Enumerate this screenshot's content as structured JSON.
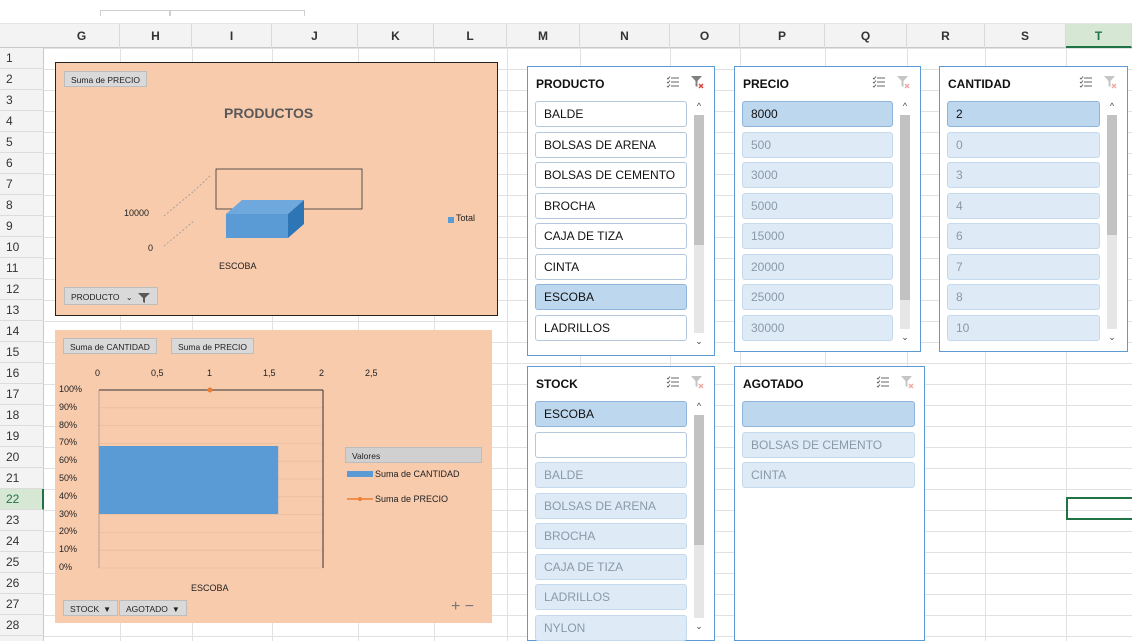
{
  "columns": [
    "G",
    "H",
    "I",
    "J",
    "K",
    "L",
    "M",
    "N",
    "O",
    "P",
    "Q",
    "R",
    "S",
    "T"
  ],
  "selected_column": "T",
  "rows": [
    "1",
    "2",
    "3",
    "4",
    "5",
    "6",
    "7",
    "8",
    "9",
    "10",
    "11",
    "12",
    "13",
    "14",
    "15",
    "16",
    "17",
    "18",
    "19",
    "20",
    "21",
    "22",
    "23",
    "24",
    "25",
    "26",
    "27",
    "28"
  ],
  "selected_row": "22",
  "chart1": {
    "type": "bar3d",
    "title": "PRODUCTOS",
    "value_field": "Suma de PRECIO",
    "filter_field": "PRODUCTO",
    "y_ticks": [
      "0",
      "10000"
    ],
    "category": "ESCOBA",
    "series_name": "Total",
    "value": 8000,
    "ylim": [
      0,
      20000
    ],
    "colors": {
      "bar": "#5b9bd5"
    }
  },
  "chart2": {
    "field_buttons": [
      "Suma de CANTIDAD",
      "Suma de PRECIO"
    ],
    "filter_fields": [
      "STOCK",
      "AGOTADO"
    ],
    "top_axis_ticks": [
      "0",
      "0,5",
      "1",
      "1,5",
      "2",
      "2,5"
    ],
    "left_axis_ticks": [
      "100%",
      "90%",
      "80%",
      "70%",
      "60%",
      "50%",
      "40%",
      "30%",
      "20%",
      "10%",
      "0%"
    ],
    "category": "ESCOBA",
    "legend_title": "Valores",
    "expand_collapse": "+ −"
  },
  "chart_data": [
    {
      "type": "bar",
      "title": "PRODUCTOS",
      "categories": [
        "ESCOBA"
      ],
      "series": [
        {
          "name": "Total",
          "values": [
            8000
          ]
        }
      ]
    },
    {
      "type": "bar",
      "categories": [
        "ESCOBA"
      ],
      "series": [
        {
          "name": "Suma de CANTIDAD",
          "values": [
            2
          ]
        },
        {
          "name": "Suma de PRECIO",
          "values": [
            8000
          ]
        }
      ],
      "xlim": [
        0,
        2.5
      ]
    }
  ],
  "slicers": {
    "producto": {
      "title": "PRODUCTO",
      "items": [
        {
          "label": "BALDE",
          "state": "on"
        },
        {
          "label": "BOLSAS DE ARENA",
          "state": "on"
        },
        {
          "label": "BOLSAS DE CEMENTO",
          "state": "on"
        },
        {
          "label": "BROCHA",
          "state": "on"
        },
        {
          "label": "CAJA DE TIZA",
          "state": "on"
        },
        {
          "label": "CINTA",
          "state": "on"
        },
        {
          "label": "ESCOBA",
          "state": "sel"
        },
        {
          "label": "LADRILLOS",
          "state": "on"
        }
      ]
    },
    "precio": {
      "title": "PRECIO",
      "items": [
        {
          "label": "8000",
          "state": "sel"
        },
        {
          "label": "500",
          "state": "nd"
        },
        {
          "label": "3000",
          "state": "nd"
        },
        {
          "label": "5000",
          "state": "nd"
        },
        {
          "label": "15000",
          "state": "nd"
        },
        {
          "label": "20000",
          "state": "nd"
        },
        {
          "label": "25000",
          "state": "nd"
        },
        {
          "label": "30000",
          "state": "nd"
        }
      ]
    },
    "cantidad": {
      "title": "CANTIDAD",
      "items": [
        {
          "label": "2",
          "state": "sel"
        },
        {
          "label": "0",
          "state": "nd"
        },
        {
          "label": "3",
          "state": "nd"
        },
        {
          "label": "4",
          "state": "nd"
        },
        {
          "label": "6",
          "state": "nd"
        },
        {
          "label": "7",
          "state": "nd"
        },
        {
          "label": "8",
          "state": "nd"
        },
        {
          "label": "10",
          "state": "nd"
        }
      ]
    },
    "stock": {
      "title": "STOCK",
      "items": [
        {
          "label": "ESCOBA",
          "state": "sel"
        },
        {
          "label": "",
          "state": "on"
        },
        {
          "label": "BALDE",
          "state": "nd"
        },
        {
          "label": "BOLSAS DE ARENA",
          "state": "nd"
        },
        {
          "label": "BROCHA",
          "state": "nd"
        },
        {
          "label": "CAJA DE TIZA",
          "state": "nd"
        },
        {
          "label": "LADRILLOS",
          "state": "nd"
        },
        {
          "label": "NYLON",
          "state": "nd"
        }
      ]
    },
    "agotado": {
      "title": "AGOTADO",
      "items": [
        {
          "label": "",
          "state": "sel"
        },
        {
          "label": "BOLSAS DE CEMENTO",
          "state": "nd"
        },
        {
          "label": "CINTA",
          "state": "nd"
        }
      ]
    }
  },
  "colors": {
    "accent_green": "#217346",
    "chart_bg": "#f8cbad",
    "slicer_border": "#5b9bd5",
    "slicer_selected": "#bdd7ee",
    "slicer_nodata": "#deebf7"
  },
  "icons": [
    "multi-select-icon",
    "clear-filter-icon",
    "filter-funnel-icon",
    "dropdown-arrow-icon",
    "scroll-up-arrow-icon",
    "scroll-down-arrow-icon"
  ]
}
